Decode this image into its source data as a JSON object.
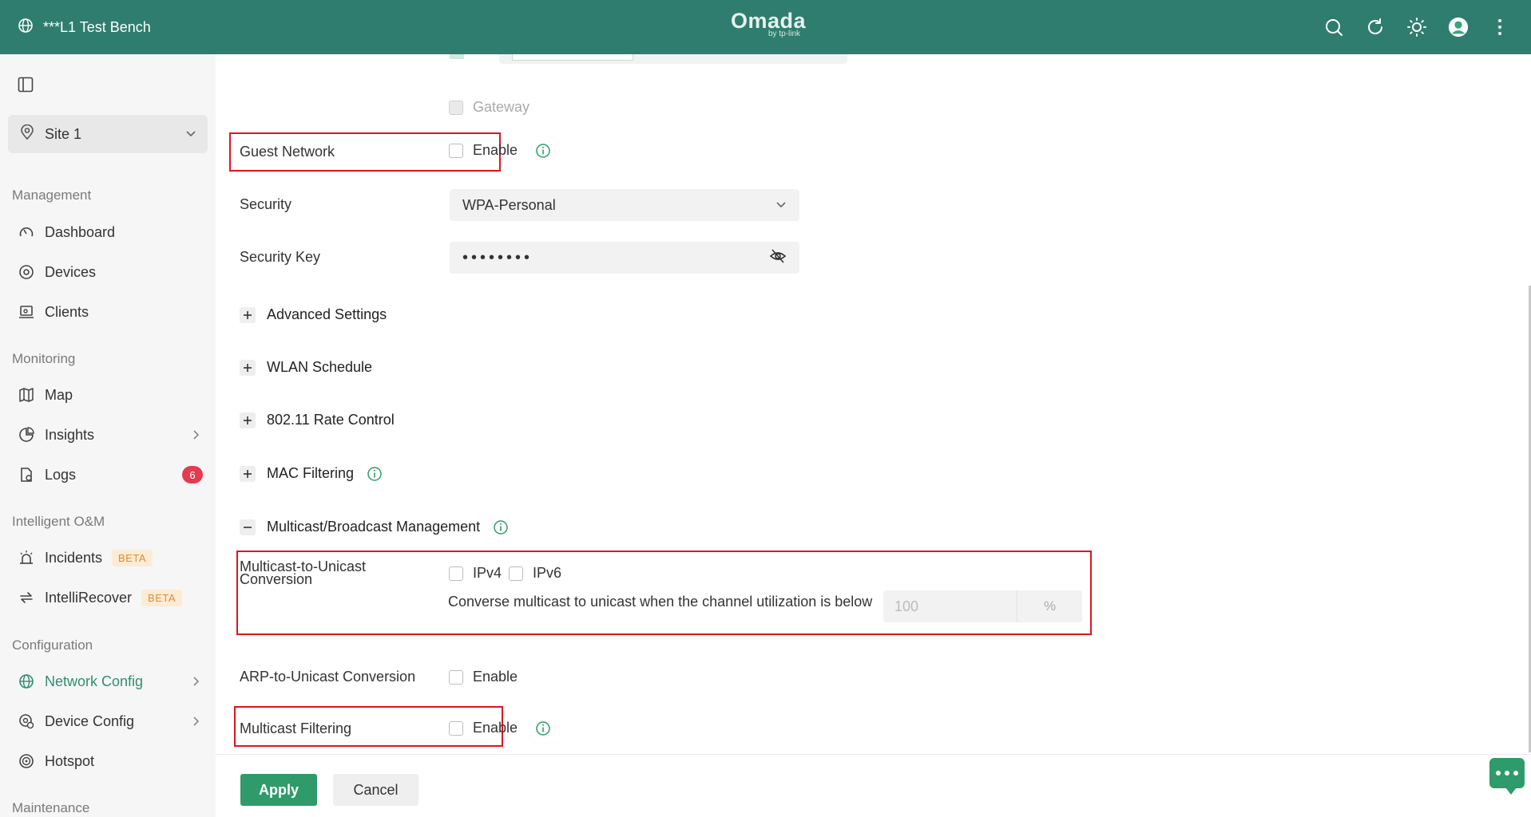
{
  "header": {
    "site_name": "***L1 Test Bench",
    "logo": "Omada",
    "logo_sub": "by tp-link",
    "icons": [
      "search-icon",
      "refresh-icon",
      "theme-icon",
      "avatar",
      "more-icon"
    ]
  },
  "sidebar": {
    "site_select": "Site 1",
    "sections": {
      "management": "Management",
      "monitoring": "Monitoring",
      "intelligent": "Intelligent O&M",
      "configuration": "Configuration",
      "maintenance": "Maintenance"
    },
    "items": {
      "dashboard": "Dashboard",
      "devices": "Devices",
      "clients": "Clients",
      "map": "Map",
      "insights": "Insights",
      "logs": "Logs",
      "logs_badge": "6",
      "incidents": "Incidents",
      "intellirecover": "IntelliRecover",
      "beta": "BETA",
      "network_config": "Network Config",
      "device_config": "Device Config",
      "hotspot": "Hotspot"
    }
  },
  "form": {
    "gateway_label": "Gateway",
    "guest_network_label": "Guest Network",
    "enable": "Enable",
    "security_label": "Security",
    "security_value": "WPA-Personal",
    "security_key_label": "Security Key",
    "security_key_value": "••••••••",
    "advanced_settings": "Advanced Settings",
    "wlan_schedule": "WLAN Schedule",
    "rate_control": "802.11 Rate Control",
    "mac_filtering": "MAC Filtering",
    "multicast_mgmt": "Multicast/Broadcast Management",
    "m2u_label_line1": "Multicast-to-Unicast",
    "m2u_label_line2": "Conversion",
    "ipv4": "IPv4",
    "ipv6": "IPv6",
    "converse_desc": "Converse multicast to unicast when the channel utilization is below",
    "util_placeholder": "100",
    "util_unit": "%",
    "arp_label": "ARP-to-Unicast Conversion",
    "multicast_filtering_label": "Multicast Filtering"
  },
  "footer": {
    "apply": "Apply",
    "cancel": "Cancel"
  },
  "colors": {
    "header_bg": "#2f7d6e",
    "accent": "#2f9b6a",
    "highlight_box": "#e0141e"
  }
}
